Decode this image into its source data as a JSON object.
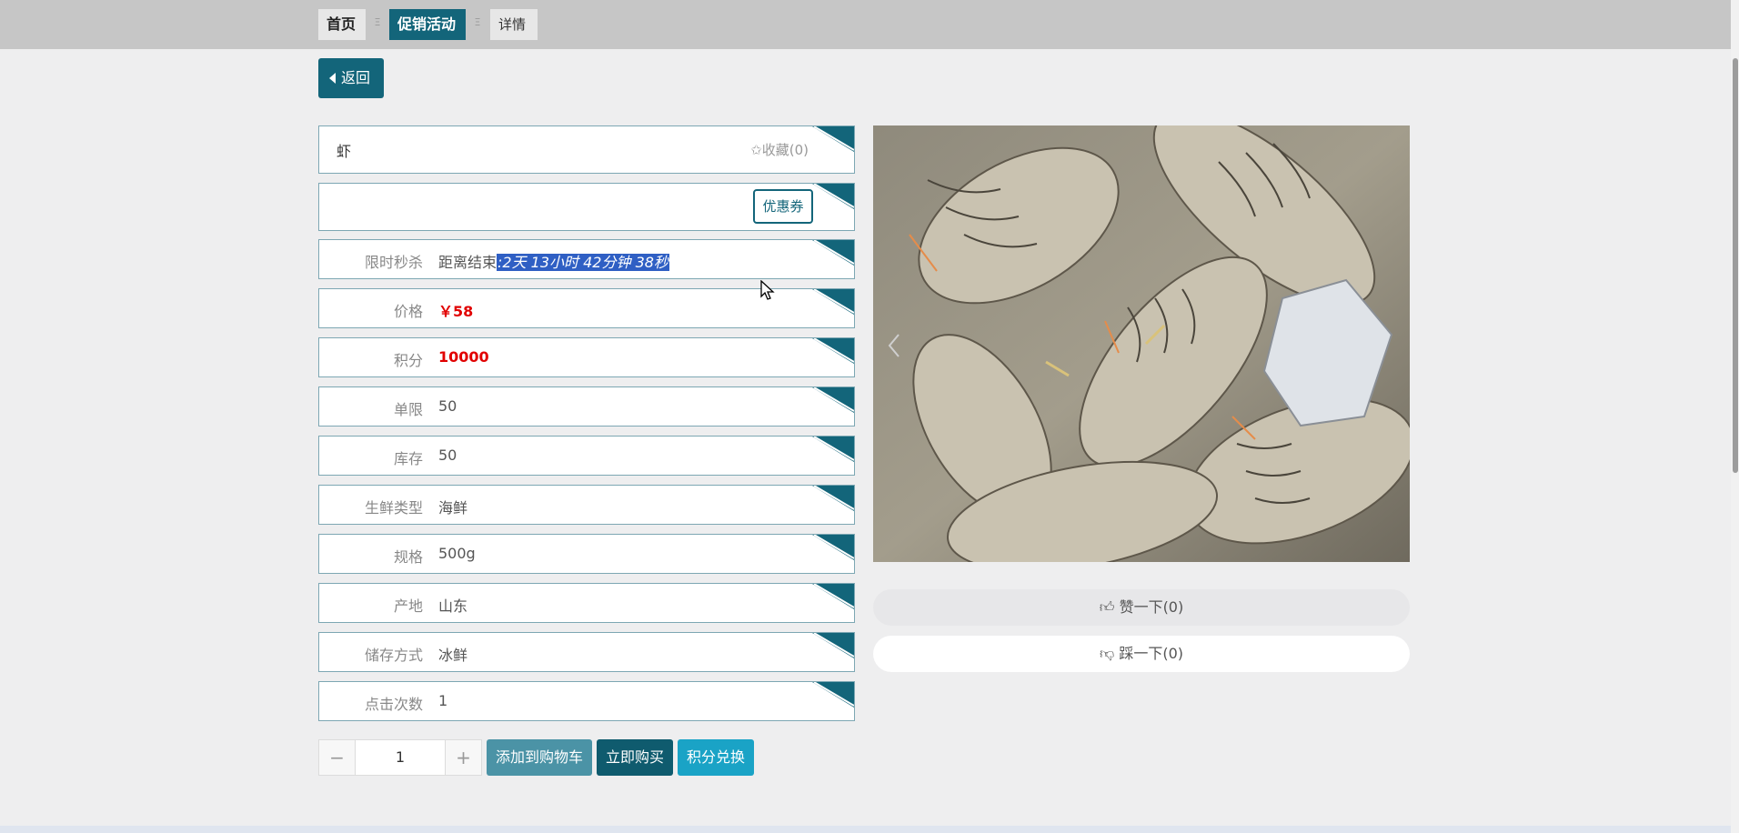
{
  "breadcrumb": {
    "home": "首页",
    "promo": "促销活动",
    "detail": "详情",
    "separator": "Ξ"
  },
  "back_label": "返回",
  "product": {
    "name": "虾",
    "favorite": "✩收藏(0)",
    "coupon": "优惠券",
    "fields": [
      {
        "label": "限时秒杀",
        "value_prefix": "距离结束",
        "value": ":2天 13小时 42分钟 38秒",
        "type": "countdown"
      },
      {
        "label": "价格",
        "value": "￥58",
        "type": "red"
      },
      {
        "label": "积分",
        "value": "10000",
        "type": "red"
      },
      {
        "label": "单限",
        "value": "50"
      },
      {
        "label": "库存",
        "value": "50"
      },
      {
        "label": "生鲜类型",
        "value": "海鲜"
      },
      {
        "label": "规格",
        "value": "500g"
      },
      {
        "label": "产地",
        "value": "山东"
      },
      {
        "label": "储存方式",
        "value": "冰鲜"
      },
      {
        "label": "点击次数",
        "value": "1"
      }
    ]
  },
  "votes": {
    "like": "赞一下(0)",
    "dislike": "踩一下(0)"
  },
  "quantity": {
    "minus": "−",
    "value": "1",
    "plus": "+"
  },
  "actions": {
    "add_to_cart": "添加到购物车",
    "buy_now": "立即购买",
    "points_exchange": "积分兑换"
  },
  "colors": {
    "primary": "#13657a",
    "price_red": "#e10000",
    "selection": "#2f5fc4"
  }
}
